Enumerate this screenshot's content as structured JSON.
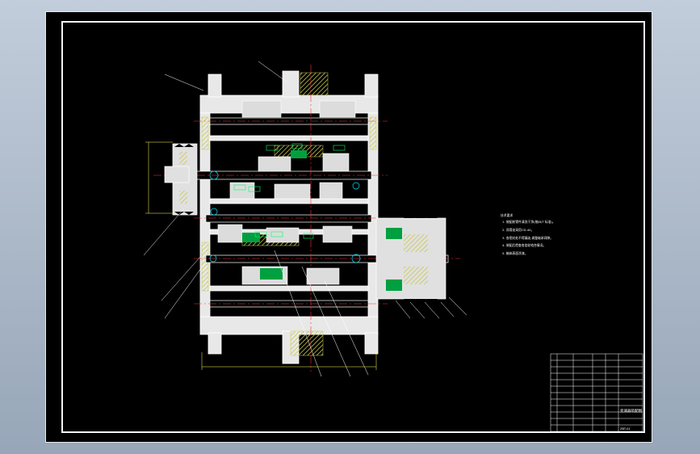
{
  "drawing": {
    "background_color": "#000000",
    "line_color": "#ffffff",
    "section_hatch_color": "#c8c850",
    "centerline_color": "#ff3030",
    "leader_color": "#ffffff",
    "dimension_color": "#ffff55",
    "gear_label_color": "#00ff66",
    "highlight_color": "#00e0ff",
    "green_fill_color": "#00a040"
  },
  "notes": {
    "lines": [
      "技术要求",
      "1. 装配前零件清洗干净(按JB/T 标准)。",
      "2. 润滑油采用CD-40。",
      "3. 各密封处不得漏油,调整轴承间隙。",
      "4. 装配后检查各齿轮啮合情况。",
      "5. 箱体表面涂漆。"
    ]
  },
  "title_block": {
    "title": "变速器装配图",
    "code": "ZBT-01"
  }
}
